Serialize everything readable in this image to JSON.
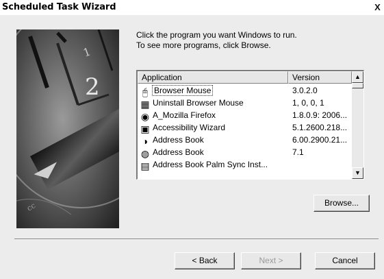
{
  "window": {
    "title": "Scheduled Task Wizard",
    "close_label": "X"
  },
  "instruction": {
    "line1": "Click the program you want Windows to run.",
    "line2": "To see more programs, click Browse."
  },
  "list": {
    "columns": [
      "Application",
      "Version"
    ],
    "rows": [
      {
        "icon": "mouse-icon",
        "application": "Browser Mouse",
        "version": "3.0.2.0",
        "selected": true
      },
      {
        "icon": "uninstall-icon",
        "application": "Uninstall Browser Mouse",
        "version": "1, 0, 0, 1"
      },
      {
        "icon": "firefox-icon",
        "application": "A_Mozilla Firefox",
        "version": "1.8.0.9: 2006..."
      },
      {
        "icon": "accessibility-icon",
        "application": "Accessibility Wizard",
        "version": "5.1.2600.218..."
      },
      {
        "icon": "address-book-icon",
        "application": "Address Book",
        "version": "6.00.2900.21..."
      },
      {
        "icon": "address-book-icon",
        "application": "Address Book",
        "version": "7.1"
      },
      {
        "icon": "palm-sync-icon",
        "application": "Address Book Palm Sync Inst...",
        "version": ""
      }
    ]
  },
  "buttons": {
    "browse": "Browse...",
    "back": "< Back",
    "next": "Next >",
    "cancel": "Cancel"
  },
  "scrollbar": {
    "up_arrow": "▲",
    "down_arrow": "▼"
  }
}
